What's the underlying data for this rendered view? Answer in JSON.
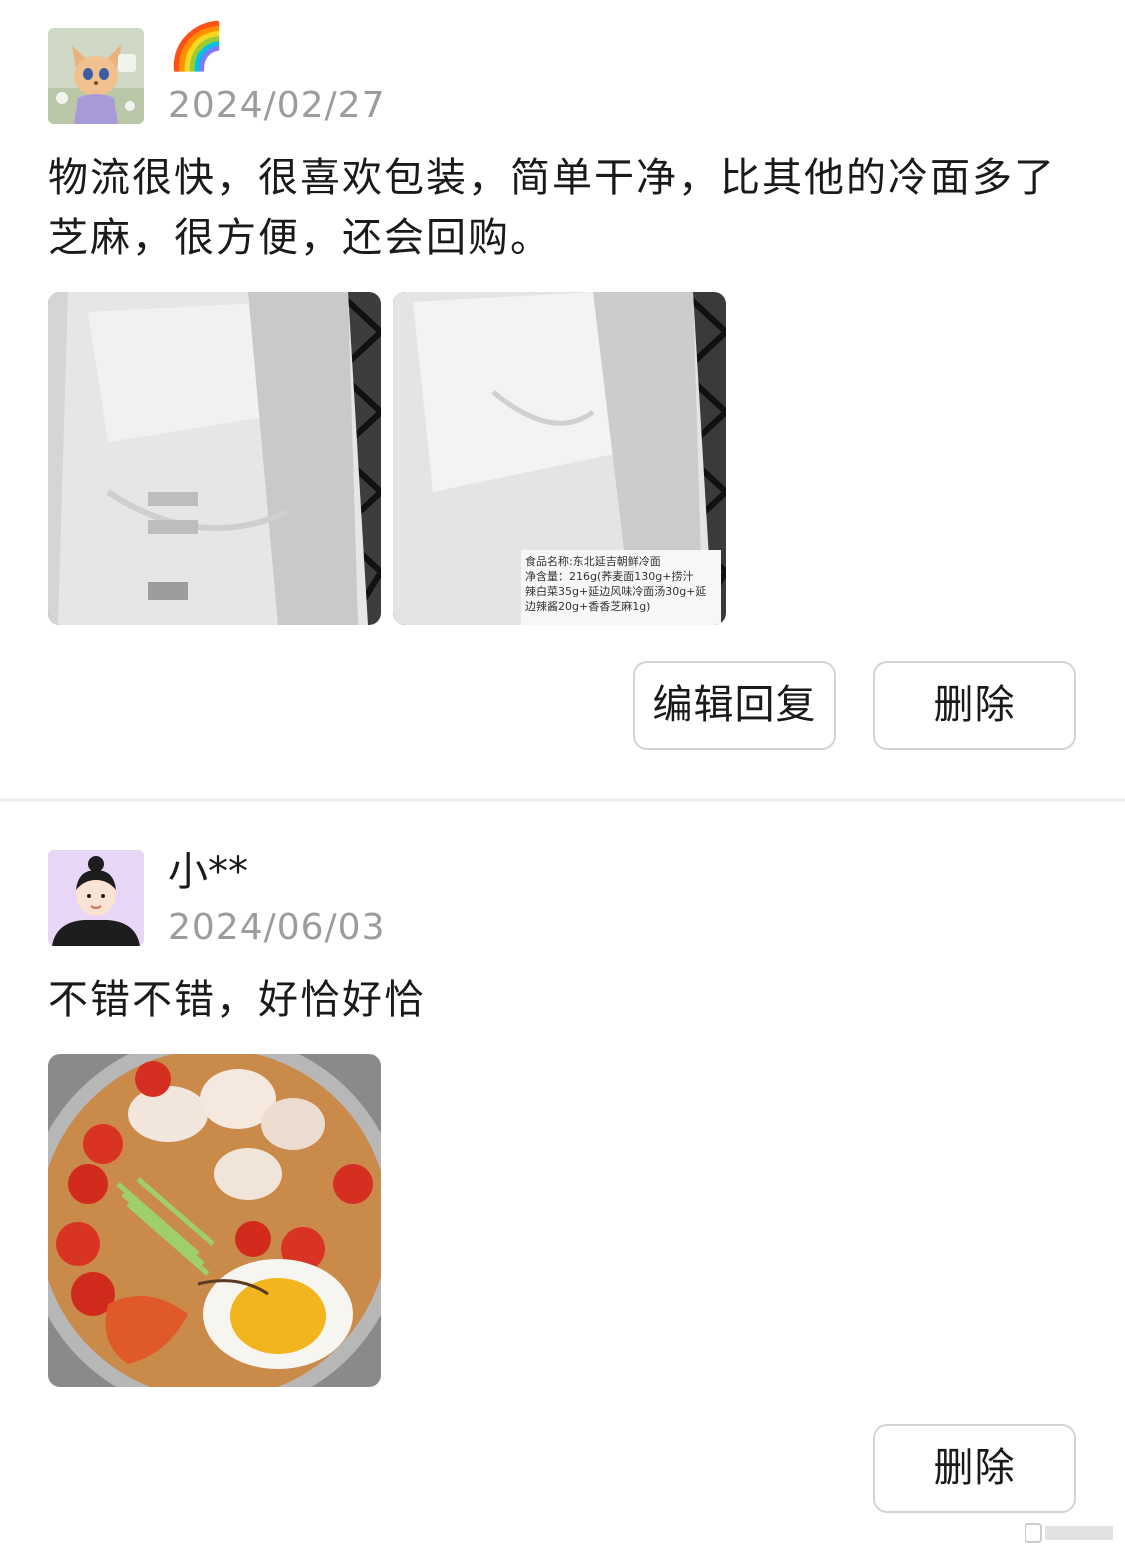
{
  "reviews": [
    {
      "username": "🌈",
      "date": "2024/02/27",
      "text": "物流很快，很喜欢包装，简单干净，比其他的冷面多了芝麻，很方便，还会回购。",
      "photo_label_lines": [
        "食品名称:东北延吉朝鲜冷面",
        "净含量：216g(荞麦面130g+捞汁",
        "辣白菜35g+延边风味冷面汤30g+延",
        "边辣酱20g+香香芝麻1g)"
      ],
      "buttons": {
        "edit": "编辑回复",
        "delete": "删除"
      }
    },
    {
      "username": "小**",
      "date": "2024/06/03",
      "text": "不错不错，好恰好恰",
      "buttons": {
        "delete": "删除"
      }
    }
  ]
}
